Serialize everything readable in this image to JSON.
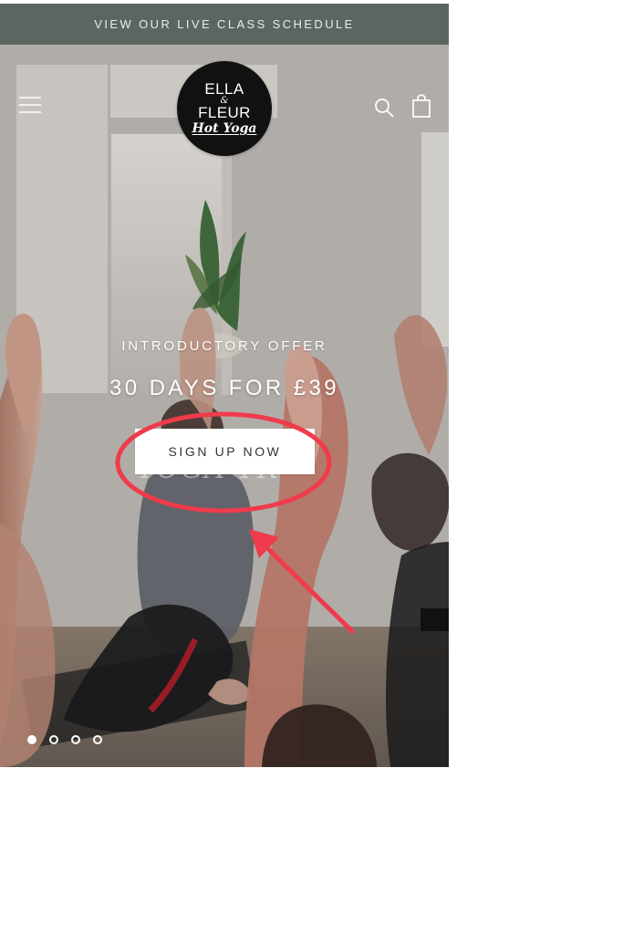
{
  "announcement": {
    "text": "VIEW OUR LIVE CLASS SCHEDULE",
    "background": "#5b6661",
    "text_color": "#e9ecea"
  },
  "header": {
    "menu_icon": "menu-icon",
    "search_icon": "search-icon",
    "cart_icon": "shopping-bag-icon",
    "logo": {
      "line1": "ELLA",
      "line2": "&",
      "line3": "FLEUR",
      "line4": "Hot Yoga",
      "background": "#111111"
    }
  },
  "hero": {
    "offer_label": "INTRODUCTORY OFFER",
    "offer_title": "30 DAYS FOR £39",
    "cta": "SIGN UP NOW",
    "ghost_text": "YOGA TR",
    "slide_dots": [
      {
        "state": "active"
      },
      {
        "state": "inactive"
      },
      {
        "state": "inactive"
      },
      {
        "state": "inactive"
      }
    ]
  },
  "annotation": {
    "circle_color": "#ef3b4b",
    "arrow_color": "#ef3b4b"
  }
}
